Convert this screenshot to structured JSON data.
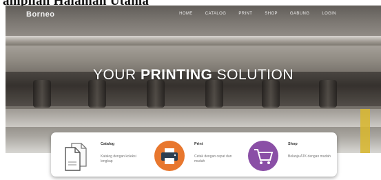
{
  "caption": "ampilan Halaman Utama",
  "navbar": {
    "brand": "Borneo",
    "links": [
      "Home",
      "Catalog",
      "Print",
      "Shop",
      "Gabung",
      "Login"
    ]
  },
  "hero": {
    "headline_prefix": "YOUR",
    "headline_strong": "PRINTING",
    "headline_suffix": "SOLUTION"
  },
  "services": [
    {
      "icon": "documents-icon",
      "title": "Catalog",
      "desc": "Katalog dengan koleksi lengkap"
    },
    {
      "icon": "printer-icon",
      "title": "Print",
      "desc": "Cetak dengan cepat dan mudah"
    },
    {
      "icon": "shopping-cart-icon",
      "title": "Shop",
      "desc": "Belanja ATK dengan mudah"
    }
  ],
  "colors": {
    "print_icon": "#e8772e",
    "shop_icon": "#8a4fa6",
    "accent": "#d9b72d"
  }
}
